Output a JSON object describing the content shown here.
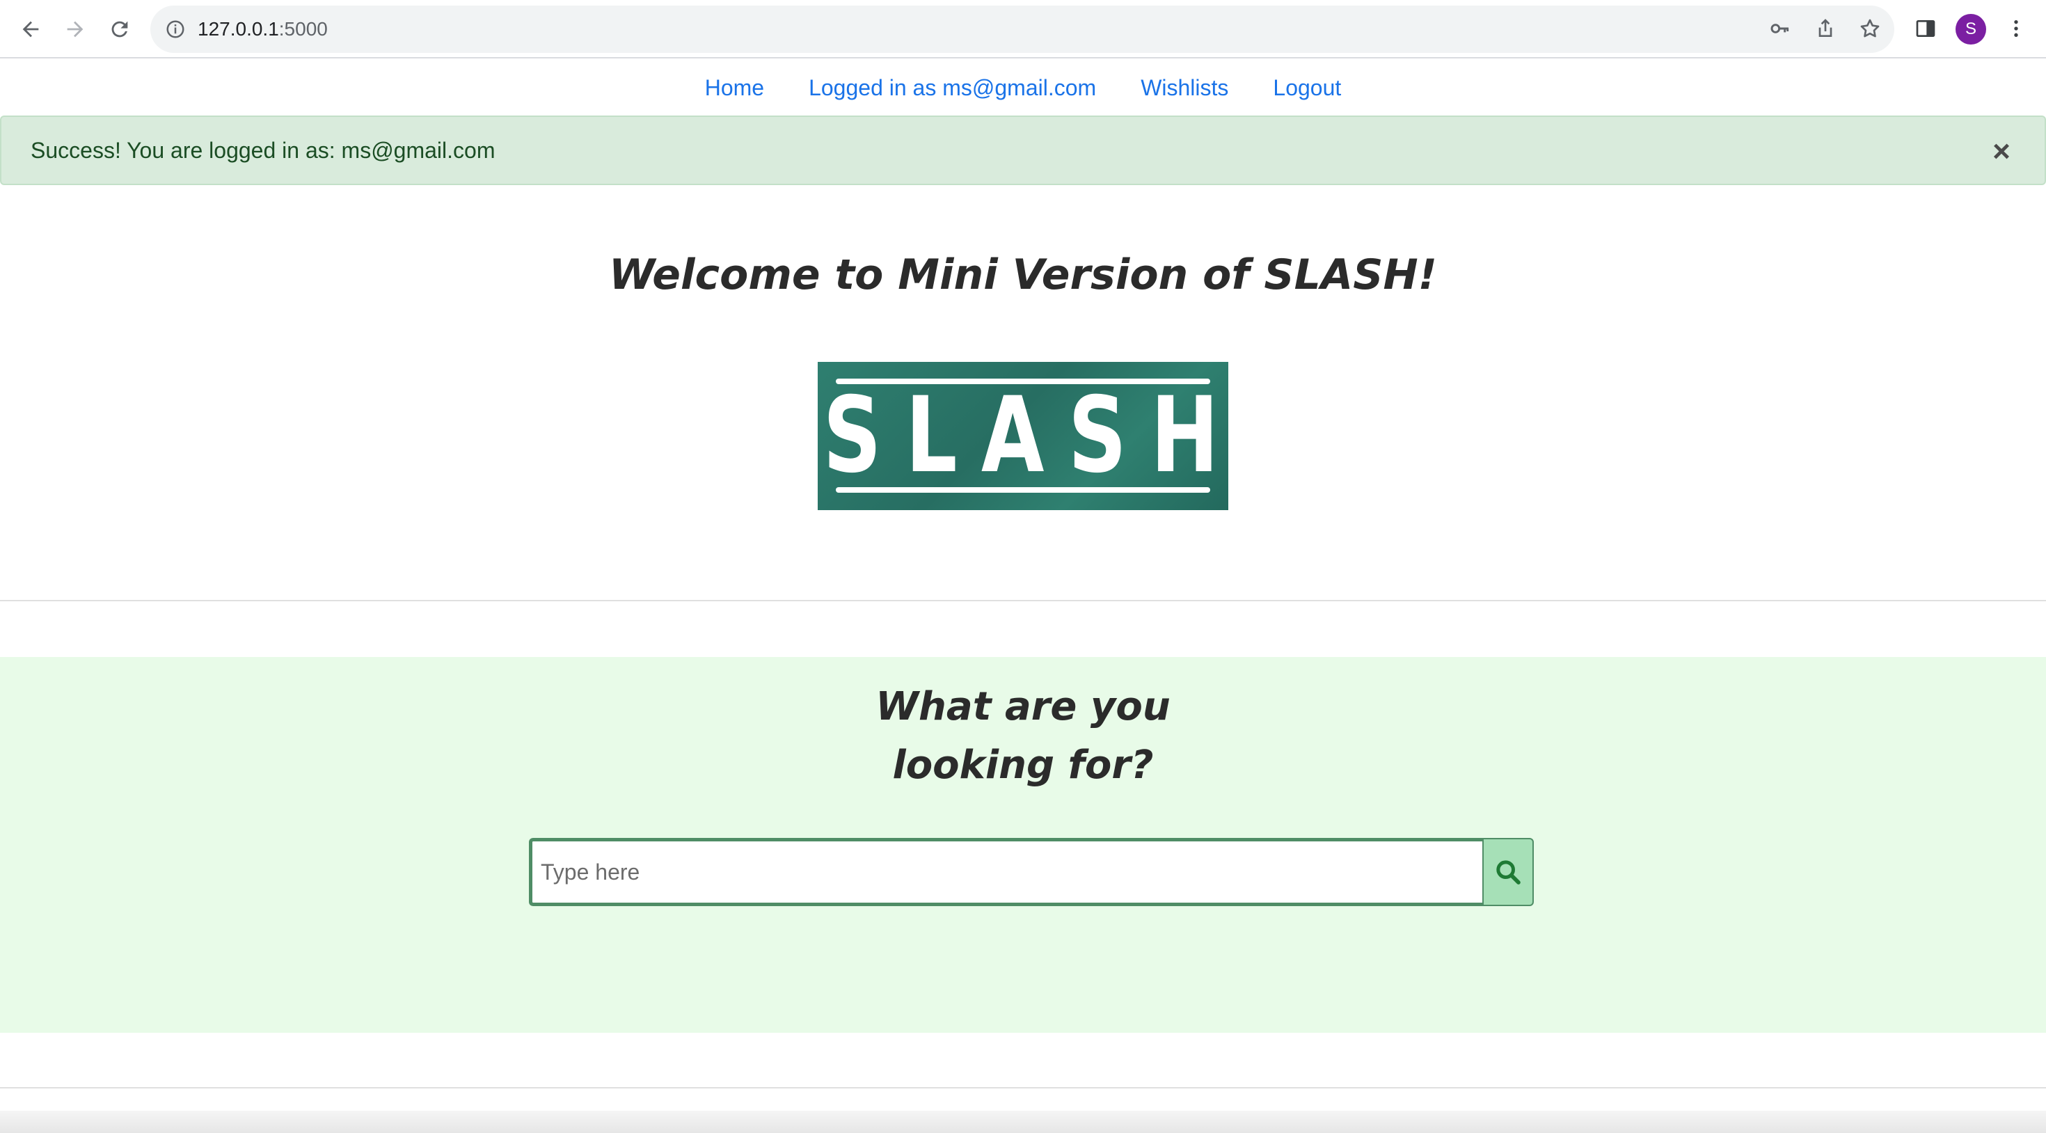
{
  "browser": {
    "url_host": "127.0.0.1",
    "url_port": ":5000",
    "profile_initial": "S"
  },
  "nav": {
    "home": "Home",
    "logged_in": "Logged in as ms@gmail.com",
    "wishlists": "Wishlists",
    "logout": "Logout"
  },
  "alert": {
    "message": "Success! You are logged in as: ms@gmail.com",
    "close": "×"
  },
  "hero": {
    "title": "Welcome to Mini Version of SLASH!",
    "logo_text": "SLASH"
  },
  "search": {
    "title_line1": "What are you",
    "title_line2": "looking for?",
    "placeholder": "Type here",
    "value": ""
  },
  "colors": {
    "link": "#1a73e8",
    "alert_bg": "#d9ebdc",
    "search_band_bg": "#e8fbe8",
    "logo_green": "#2f7f70",
    "search_btn_bg": "#a6e0b7"
  }
}
